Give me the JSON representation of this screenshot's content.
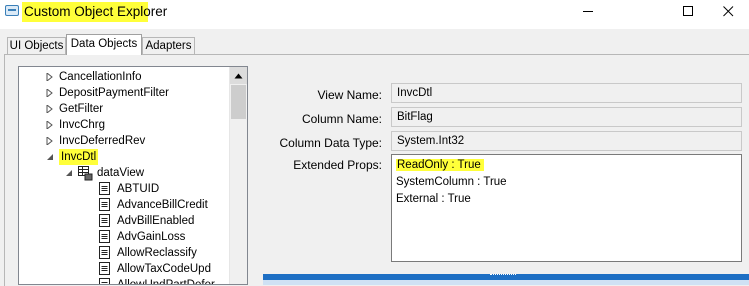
{
  "window": {
    "title": "Custom Object Explorer"
  },
  "tabs": [
    {
      "label": "UI Objects",
      "active": false
    },
    {
      "label": "Data Objects",
      "active": true
    },
    {
      "label": "Adapters",
      "active": false
    }
  ],
  "tree": {
    "items": [
      {
        "label": "CancellationInfo"
      },
      {
        "label": "DepositPaymentFilter"
      },
      {
        "label": "GetFilter"
      },
      {
        "label": "InvcChrg"
      },
      {
        "label": "InvcDeferredRev"
      },
      {
        "label": "InvcDtl"
      },
      {
        "label": "dataView"
      },
      {
        "label": "ABTUID"
      },
      {
        "label": "AdvanceBillCredit"
      },
      {
        "label": "AdvBillEnabled"
      },
      {
        "label": "AdvGainLoss"
      },
      {
        "label": "AllowReclassify"
      },
      {
        "label": "AllowTaxCodeUpd"
      },
      {
        "label": "AllowUndPartDefer"
      }
    ]
  },
  "details": {
    "view_name_label": "View Name:",
    "view_name_value": "InvcDtl",
    "column_name_label": "Column Name:",
    "column_name_value": "BitFlag",
    "column_type_label": "Column Data Type:",
    "column_type_value": "System.Int32",
    "extended_label": "Extended Props:",
    "extended_props": [
      "ReadOnly : True",
      "SystemColumn : True",
      "External : True"
    ]
  },
  "colors": {
    "highlight": "#ffff3a",
    "bottom_strip": "#1e6fc4"
  },
  "icons": [
    "app-window-icon",
    "minimize-icon",
    "maximize-icon",
    "close-icon",
    "expand-arrow-icon",
    "collapse-arrow-icon",
    "dataview-grid-icon",
    "column-field-icon",
    "scroll-up-icon"
  ]
}
